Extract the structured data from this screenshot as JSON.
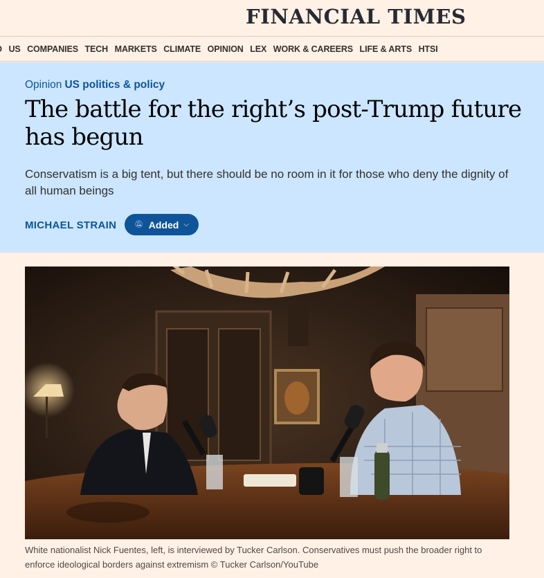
{
  "masthead": {
    "logo": "FINANCIAL TIMES"
  },
  "nav": {
    "items": [
      "D",
      "US",
      "COMPANIES",
      "TECH",
      "MARKETS",
      "CLIMATE",
      "OPINION",
      "LEX",
      "WORK & CAREERS",
      "LIFE & ARTS",
      "HTSI"
    ]
  },
  "article": {
    "kind": "Opinion",
    "topic": "US politics & policy",
    "headline": "The battle for the right’s post-Trump future has begun",
    "standfirst": "Conservatism is a big tent, but there should be no room in it for those who deny the dignity of all human beings",
    "author": "MICHAEL STRAIN",
    "follow_label": "Added",
    "follow_icon": "bell-off-icon"
  },
  "image": {
    "caption": "White nationalist Nick Fuentes, left, is interviewed by Tucker Carlson. Conservatives must push the broader right to enforce ideological borders against extremism © Tucker Carlson/YouTube"
  },
  "colors": {
    "page_bg": "#fff1e5",
    "hero_bg": "#cce6ff",
    "accent_blue": "#0d5499",
    "button_bg": "#0f5499"
  }
}
